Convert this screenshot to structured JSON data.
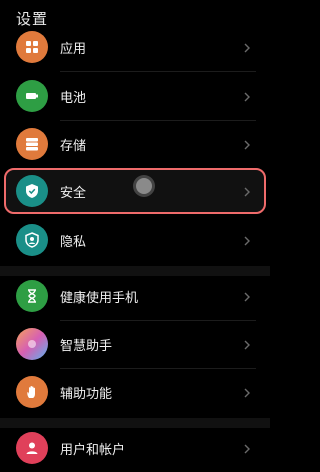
{
  "header": {
    "title": "设置"
  },
  "items": [
    {
      "label": "应用",
      "icon": "apps-icon",
      "color": "#e07a3c"
    },
    {
      "label": "电池",
      "icon": "battery-icon",
      "color": "#2e9e44"
    },
    {
      "label": "存储",
      "icon": "storage-icon",
      "color": "#e07a3c"
    },
    {
      "label": "安全",
      "icon": "shield-check-icon",
      "color": "#1a8f88"
    },
    {
      "label": "隐私",
      "icon": "privacy-icon",
      "color": "#1a8f88"
    },
    {
      "label": "健康使用手机",
      "icon": "hourglass-icon",
      "color": "#2e9e44"
    },
    {
      "label": "智慧助手",
      "icon": "assistant-icon",
      "color": "#9a6de0"
    },
    {
      "label": "辅助功能",
      "icon": "hand-icon",
      "color": "#e07a3c"
    },
    {
      "label": "用户和帐户",
      "icon": "user-icon",
      "color": "#e0405a"
    }
  ],
  "colors": {
    "highlight_border": "#ef6b6b",
    "background": "#000000"
  }
}
